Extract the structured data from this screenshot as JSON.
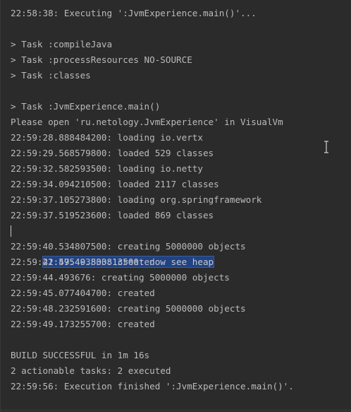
{
  "console": {
    "lines": [
      "22:58:38: Executing ':JvmExperience.main()'...",
      "",
      "> Task :compileJava",
      "> Task :processResources NO-SOURCE",
      "> Task :classes",
      "",
      "> Task :JvmExperience.main()",
      "Please open 'ru.netology.JvmExperience' in VisualVm",
      "22:59:28.888484200: loading io.vertx",
      "22:59:29.568579800: loaded 529 classes",
      "22:59:32.582593500: loading io.netty",
      "22:59:34.094210500: loaded 2117 classes",
      "22:59:37.105273800: loading org.springframework",
      "22:59:37.519523600: loaded 869 classes",
      "22:59:40.533813500: now see heap",
      "22:59:40.534807500: creating 5000000 objects",
      "22:59:41.475493800: created",
      "22:59:44.493676: creating 5000000 objects",
      "22:59:45.077404700: created",
      "22:59:48.232591600: creating 5000000 objects",
      "22:59:49.173255700: created",
      "",
      "BUILD SUCCESSFUL in 1m 16s",
      "2 actionable tasks: 2 executed",
      "22:59:56: Execution finished ':JvmExperience.main()'."
    ],
    "selected_line_index": 14
  },
  "colors": {
    "background": "#2b2b2b",
    "text": "#bbbbbb",
    "selection": "#214283"
  },
  "icons": {
    "cursor": "text-cursor-icon"
  }
}
